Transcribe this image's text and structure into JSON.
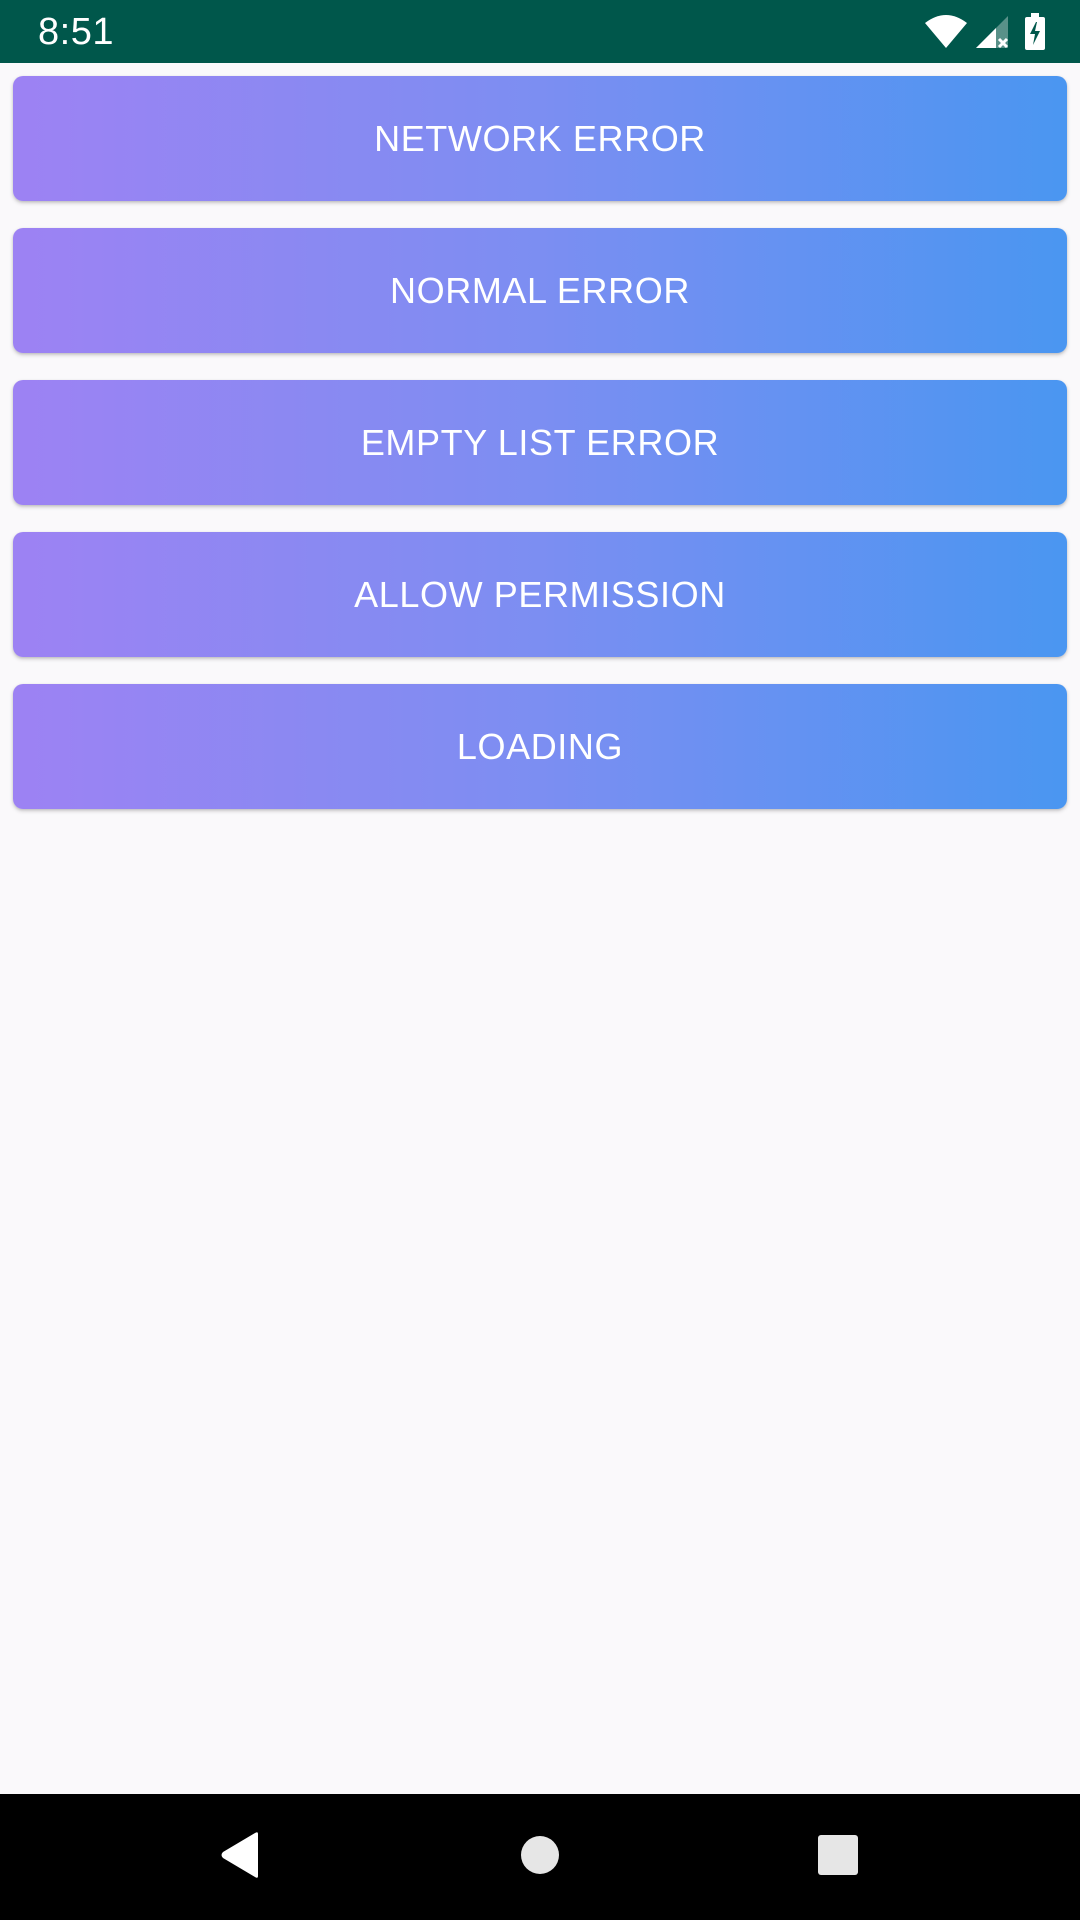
{
  "status_bar": {
    "time": "8:51",
    "icons": [
      "wifi-icon",
      "signal-icon",
      "battery-charging-icon"
    ],
    "background": "#00574b"
  },
  "buttons": [
    {
      "label": "NETWORK ERROR"
    },
    {
      "label": "NORMAL ERROR"
    },
    {
      "label": "EMPTY LIST ERROR"
    },
    {
      "label": "ALLOW PERMISSION"
    },
    {
      "label": "LOADING"
    }
  ],
  "theme": {
    "gradient_start": "#9d82f3",
    "gradient_end": "#4a96f1",
    "page_background": "#faf9fb"
  },
  "nav_bar": {
    "icons": [
      "back-icon",
      "home-icon",
      "recents-icon"
    ]
  }
}
